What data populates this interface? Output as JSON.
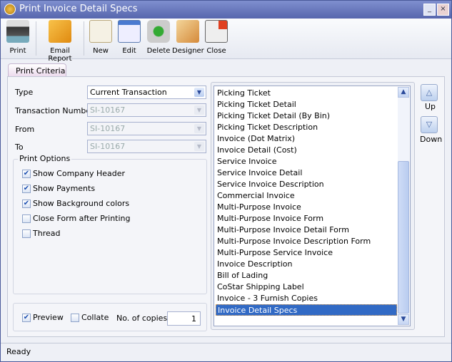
{
  "window": {
    "title": "Print Invoice Detail Specs",
    "minimize": "_",
    "close": "×"
  },
  "toolbar": [
    {
      "label": "Print",
      "icon": "printer-icon"
    },
    {
      "label": "Email Report",
      "icon": "email-icon"
    },
    {
      "label": "New",
      "icon": "new-document-icon"
    },
    {
      "label": "Edit",
      "icon": "edit-icon"
    },
    {
      "label": "Delete",
      "icon": "recycle-bin-icon"
    },
    {
      "label": "Designer",
      "icon": "designer-icon"
    },
    {
      "label": "Close",
      "icon": "close-form-icon"
    }
  ],
  "tab": "Print Criteria",
  "form": {
    "type_label": "Type",
    "type_value": "Current Transaction",
    "txn_label": "Transaction Number",
    "txn_value": "SI-10167",
    "from_label": "From",
    "from_value": "SI-10167",
    "to_label": "To",
    "to_value": "SI-10167"
  },
  "print_options": {
    "title": "Print Options",
    "options": [
      {
        "label": "Show Company Header",
        "checked": true
      },
      {
        "label": "Show Payments",
        "checked": true
      },
      {
        "label": "Show Background colors",
        "checked": true
      },
      {
        "label": "Close Form after Printing",
        "checked": false
      },
      {
        "label": "Thread",
        "checked": false
      }
    ]
  },
  "bottom": {
    "preview": "Preview",
    "preview_checked": true,
    "collate": "Collate",
    "collate_checked": false,
    "copies_label": "No. of copies",
    "copies": "1"
  },
  "reports": [
    "Picking Ticket",
    "Picking Ticket Detail",
    "Picking Ticket Detail (By Bin)",
    "Picking Ticket Description",
    "Invoice (Dot Matrix)",
    "Invoice Detail (Cost)",
    "Service Invoice",
    "Service Invoice Detail",
    "Service Invoice Description",
    "Commercial Invoice",
    "Multi-Purpose Invoice",
    "Multi-Purpose Invoice Form",
    "Multi-Purpose Invoice Detail Form",
    "Multi-Purpose Invoice Description Form",
    "Multi-Purpose Service Invoice",
    "Invoice Description",
    "Bill of Lading",
    "CoStar Shipping Label",
    "Invoice - 3 Furnish Copies",
    "Invoice Detail Specs"
  ],
  "selected_report": "Invoice Detail Specs",
  "order": {
    "up": "Up",
    "down": "Down"
  },
  "status": "Ready"
}
